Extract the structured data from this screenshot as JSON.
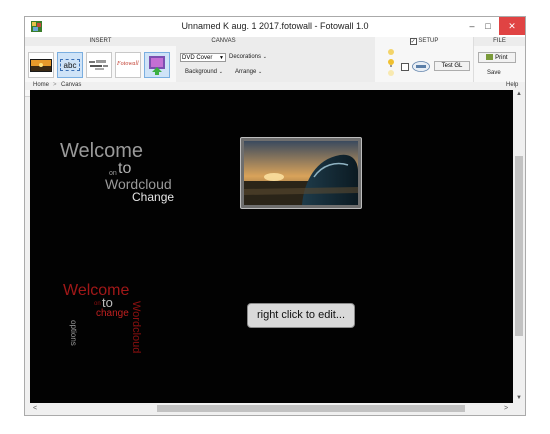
{
  "window": {
    "title": "Unnamed K aug. 1 2017.fotowall - Fotowall 1.0",
    "min": "–",
    "max": "□",
    "close": "✕"
  },
  "ribbon": {
    "insert": {
      "header": "INSERT",
      "tools": [
        {
          "name": "picture",
          "label": ""
        },
        {
          "name": "text",
          "label": "abc"
        },
        {
          "name": "wordcloud",
          "label": ""
        },
        {
          "name": "fotowall",
          "label": "Fotowall"
        },
        {
          "name": "webcam",
          "label": ""
        }
      ]
    },
    "canvas": {
      "header": "CANVAS",
      "mode_value": "DVD Cover",
      "decorations": "Decorations",
      "background": "Background",
      "arrange": "Arrange"
    },
    "setup": {
      "header": "SETUP",
      "test_gl": "Test GL"
    },
    "file": {
      "header": "FILE",
      "print": "Print",
      "save": "Save"
    }
  },
  "breadcrumb": {
    "home": "Home",
    "sep": ">",
    "canvas": "Canvas",
    "help": "Help"
  },
  "canvas": {
    "wordcloud_1": {
      "words": [
        "Welcome",
        "on",
        "to",
        "Wordcloud",
        "Change"
      ]
    },
    "wordcloud_2": {
      "words": [
        "Welcome",
        "on",
        "to",
        "change",
        "options",
        "Wordcloud"
      ]
    },
    "edit_hint": "right click to edit..."
  },
  "scrollbars": {
    "up": "▲",
    "down": "▼",
    "left": "<",
    "right": ">"
  }
}
